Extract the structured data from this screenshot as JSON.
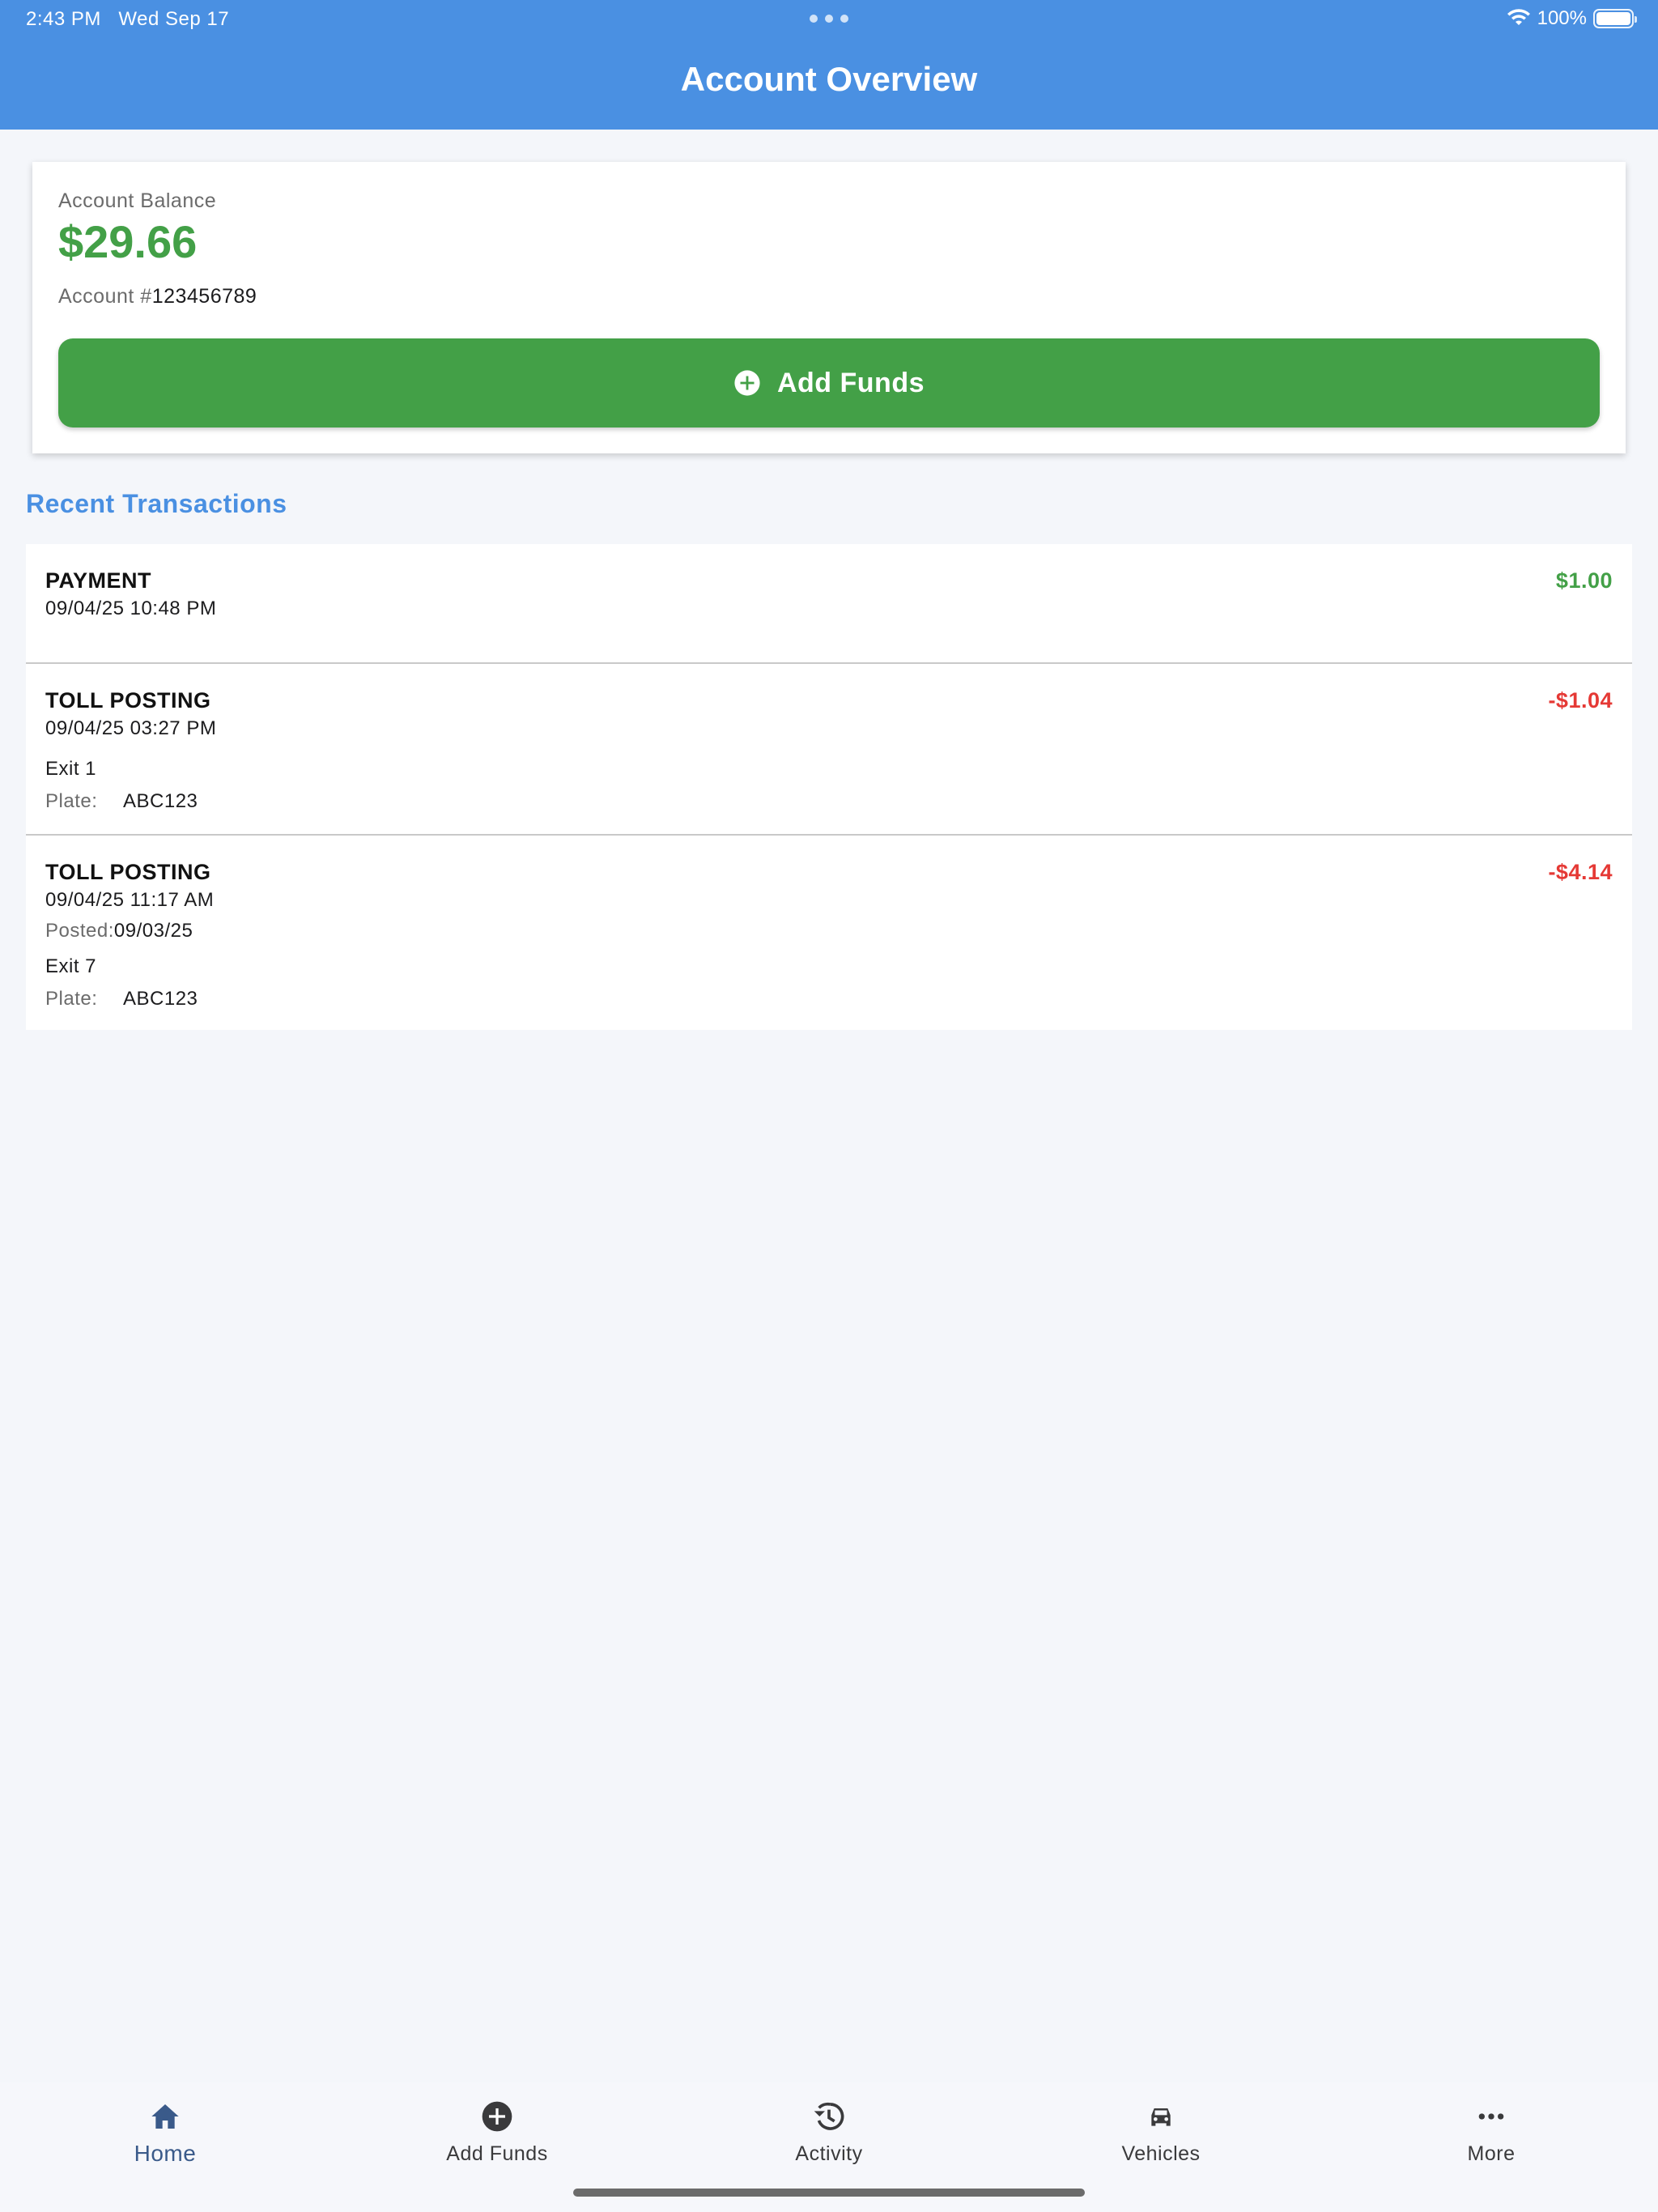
{
  "status_bar": {
    "time": "2:43 PM",
    "date": "Wed Sep 17",
    "battery": "100%"
  },
  "header": {
    "title": "Account Overview"
  },
  "balance": {
    "label": "Account Balance",
    "amount": "$29.66",
    "account_label": "Account #",
    "account_number": "123456789",
    "add_funds_label": "Add Funds"
  },
  "transactions_title": "Recent Transactions",
  "transactions": [
    {
      "type": "PAYMENT",
      "date": "09/04/25 10:48 PM",
      "amount": "$1.00",
      "kind": "positive"
    },
    {
      "type": "TOLL POSTING",
      "date": "09/04/25 03:27 PM",
      "amount": "-$1.04",
      "kind": "negative",
      "exit": "Exit 1",
      "plate_label": "Plate:",
      "plate": "ABC123"
    },
    {
      "type": "TOLL POSTING",
      "date": "09/04/25 11:17 AM",
      "amount": "-$4.14",
      "kind": "negative",
      "posted_label": "Posted:",
      "posted": "09/03/25",
      "exit": "Exit 7",
      "plate_label": "Plate:",
      "plate": "ABC123"
    }
  ],
  "tabbar": {
    "items": [
      {
        "label": "Home",
        "icon": "home-icon",
        "active": true
      },
      {
        "label": "Add Funds",
        "icon": "plus-circle-icon"
      },
      {
        "label": "Activity",
        "icon": "history-icon"
      },
      {
        "label": "Vehicles",
        "icon": "car-icon"
      },
      {
        "label": "More",
        "icon": "more-icon"
      }
    ]
  },
  "colors": {
    "header": "#4a90e2",
    "positive": "#43a047",
    "negative": "#e53935"
  }
}
